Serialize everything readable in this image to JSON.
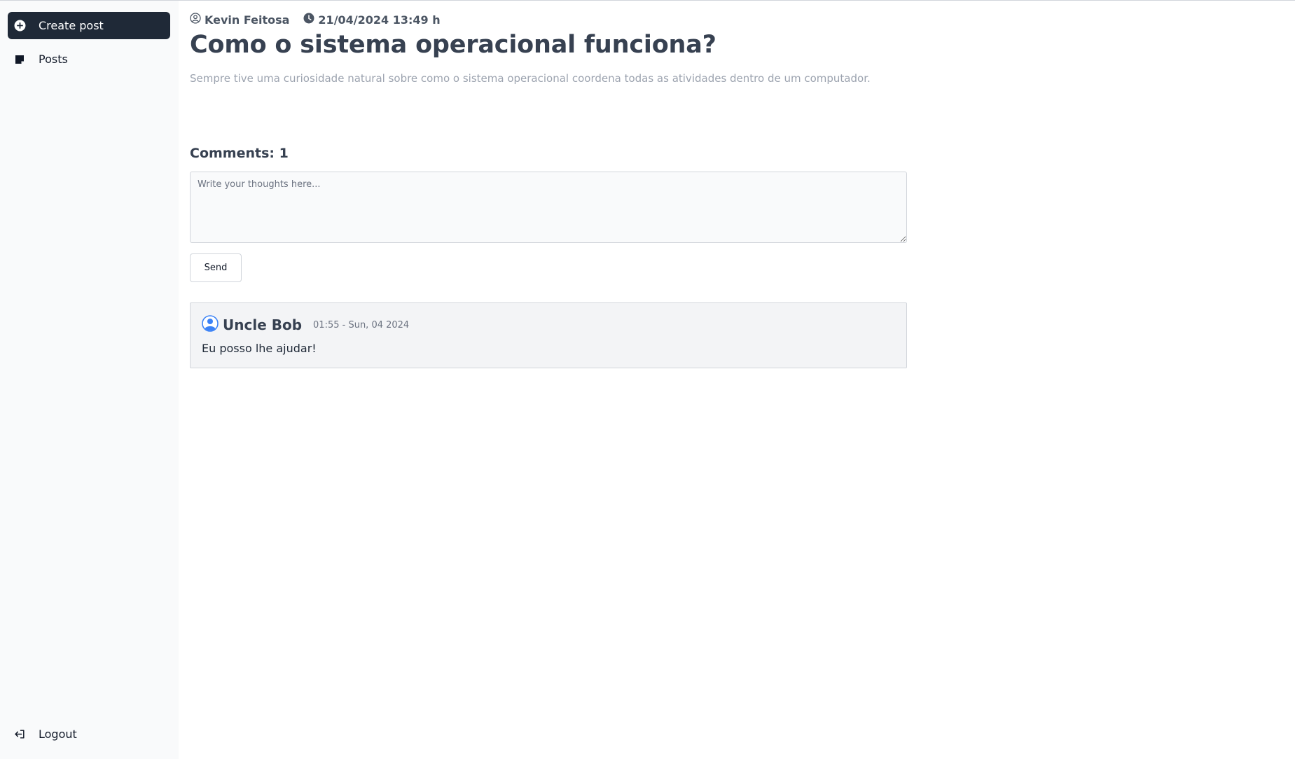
{
  "sidebar": {
    "create_post_label": "Create post",
    "posts_label": "Posts",
    "logout_label": "Logout"
  },
  "post": {
    "author": "Kevin Feitosa",
    "datetime": "21/04/2024 13:49 h",
    "title": "Como o sistema operacional funciona?",
    "description": "Sempre tive uma curiosidade natural sobre como o sistema operacional coordena todas as atividades dentro de um computador."
  },
  "comments": {
    "count_label": "Comments: 1",
    "input_placeholder": "Write your thoughts here...",
    "input_value": "",
    "send_label": "Send",
    "items": [
      {
        "author": "Uncle Bob",
        "date": "01:55 - Sun, 04 2024",
        "text": "Eu posso lhe ajudar!"
      }
    ]
  },
  "icons": {
    "create_post": "plus-circle-icon",
    "posts": "sticky-note-icon",
    "logout": "logout-icon",
    "author": "user-circle-icon",
    "datetime": "clock-icon",
    "comment_avatar": "user-avatar-icon"
  },
  "colors": {
    "active_nav_bg": "#1f2937",
    "sidebar_bg": "#f9fafb",
    "avatar_blue": "#3b82f6"
  }
}
